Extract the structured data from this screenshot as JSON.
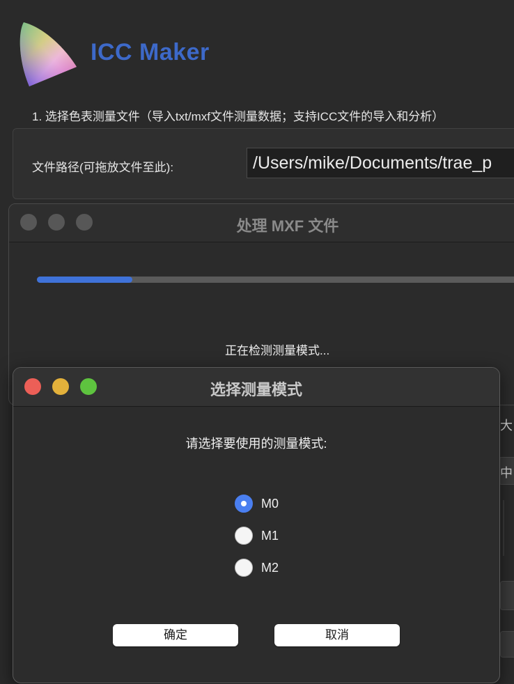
{
  "app": {
    "title": "ICC Maker",
    "logo_icon": "cie-gamut-logo-icon"
  },
  "main": {
    "step1_label": "1. 选择色表测量文件（导入txt/mxf文件测量数据；支持ICC文件的导入和分析）",
    "path_label": "文件路径(可拖放文件至此):",
    "path_value": "/Users/mike/Documents/trae_p"
  },
  "background_edge": {
    "char_top": "大",
    "char_mid": "中"
  },
  "processing_window": {
    "title": "处理 MXF 文件",
    "status": "正在检测测量模式...",
    "progress": 0.19,
    "progress_color": "#3f72d9"
  },
  "dialog": {
    "title": "选择测量模式",
    "prompt": "请选择要使用的测量模式:",
    "options": [
      {
        "label": "M0",
        "checked": true
      },
      {
        "label": "M1",
        "checked": false
      },
      {
        "label": "M2",
        "checked": false
      }
    ],
    "ok_label": "确定",
    "cancel_label": "取消",
    "accent_color": "#4a7ff0"
  }
}
